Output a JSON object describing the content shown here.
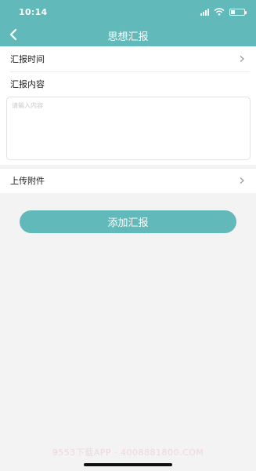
{
  "status_bar": {
    "time": "10:14"
  },
  "nav": {
    "title": "思想汇报"
  },
  "form": {
    "report_time_label": "汇报时间",
    "report_content_label": "汇报内容",
    "content_placeholder": "请输入内容",
    "attachment_label": "上传附件"
  },
  "actions": {
    "submit_label": "添加汇报"
  },
  "watermark": "9553下载APP · 4008881800.COM",
  "colors": {
    "accent": "#62b9b9",
    "background": "#f3f3f3"
  }
}
